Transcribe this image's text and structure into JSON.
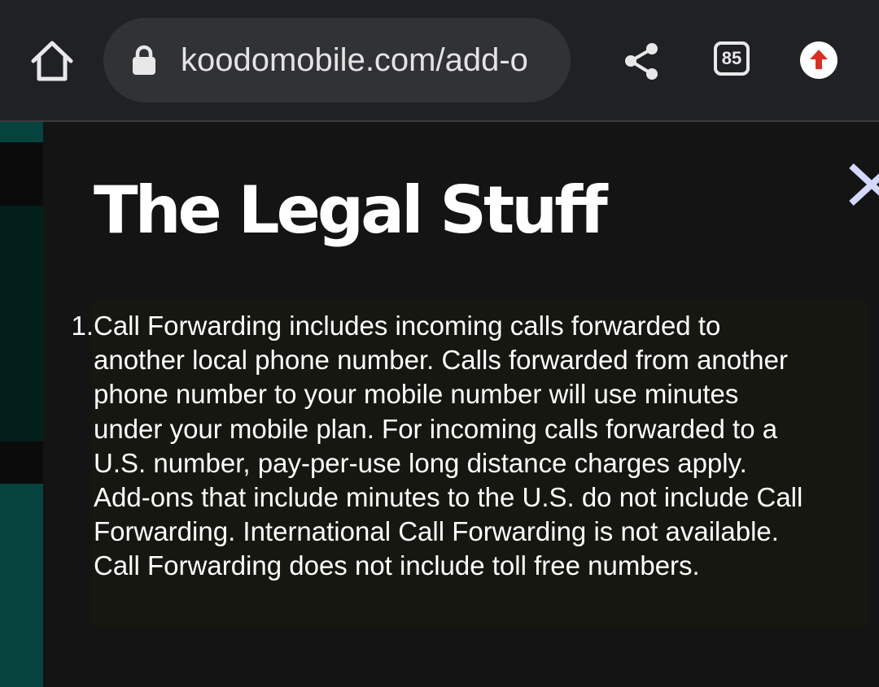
{
  "browser": {
    "url": "koodomobile.com/add-o",
    "tab_count": "85",
    "icons": {
      "home": "home-icon",
      "lock": "lock-icon",
      "share": "share-icon",
      "tabs": "tab-switcher-icon",
      "update": "update-arrow-icon"
    },
    "colors": {
      "toolbar": "#202124",
      "url_pill": "#313235",
      "update_arrow": "#d93025"
    }
  },
  "modal": {
    "title": "The Legal Stuff",
    "close_icon": "close-icon",
    "close_color": "#d5d8ff",
    "items": [
      {
        "number": "1.",
        "text": "Call Forwarding includes incoming calls forwarded to another local phone number. Calls forwarded from another phone number to your mobile number will use minutes under your mobile plan. For incoming calls forwarded to a U.S. number, pay-per-use long distance charges apply. Add-ons that include minutes to the U.S. do not include Call Forwarding. International Call Forwarding is not available. Call Forwarding does not include toll free numbers."
      }
    ]
  },
  "background_page": {
    "accent_color": "#06433f"
  }
}
